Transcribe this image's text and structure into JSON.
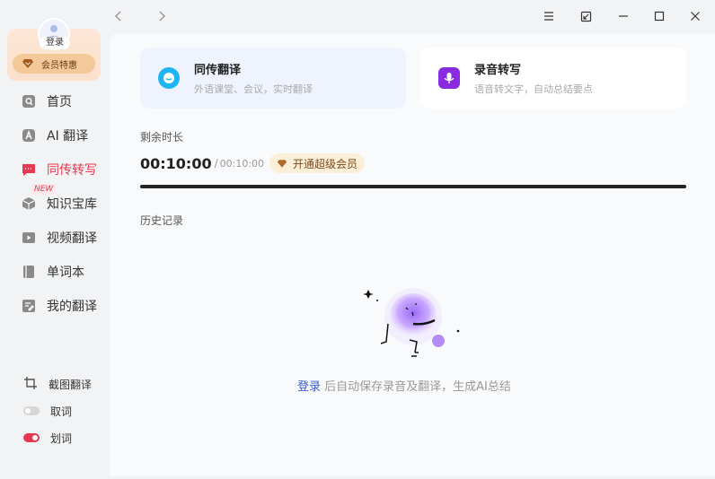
{
  "sidebar": {
    "user": {
      "login_label": "登录",
      "vip_label": "会员特惠"
    },
    "menu": [
      {
        "label": "首页",
        "icon": "home-icon"
      },
      {
        "label": "AI 翻译",
        "icon": "ai-icon"
      },
      {
        "label": "同传转写",
        "icon": "interpret-icon",
        "active": true,
        "badge": "NEW"
      },
      {
        "label": "知识宝库",
        "icon": "knowledge-icon"
      },
      {
        "label": "视频翻译",
        "icon": "video-icon"
      },
      {
        "label": "单词本",
        "icon": "wordbook-icon"
      },
      {
        "label": "我的翻译",
        "icon": "my-translation-icon"
      }
    ],
    "tools": [
      {
        "label": "截图翻译",
        "icon": "crop-icon"
      },
      {
        "label": "取词",
        "toggle": false
      },
      {
        "label": "划词",
        "toggle": true
      }
    ]
  },
  "main": {
    "cards": [
      {
        "title": "同传翻译",
        "subtitle": "外语课堂、会议，实时翻译",
        "icon": "interpret-chat-icon",
        "color": "#1fb4f2"
      },
      {
        "title": "录音转写",
        "subtitle": "语音转文字，自动总结要点",
        "icon": "mic-icon",
        "color": "#8a2be2"
      }
    ],
    "remaining": {
      "label": "剩余时长",
      "current": "00:10:00",
      "separator": "/",
      "total": "00:10:00",
      "vip_button": "开通超级会员",
      "progress": 1.0
    },
    "history": {
      "label": "历史记录",
      "empty_link": "登录",
      "empty_text": " 后自动保存录音及翻译，生成AI总结"
    }
  },
  "colors": {
    "accent": "#e8384f",
    "link": "#3b5ccc"
  }
}
